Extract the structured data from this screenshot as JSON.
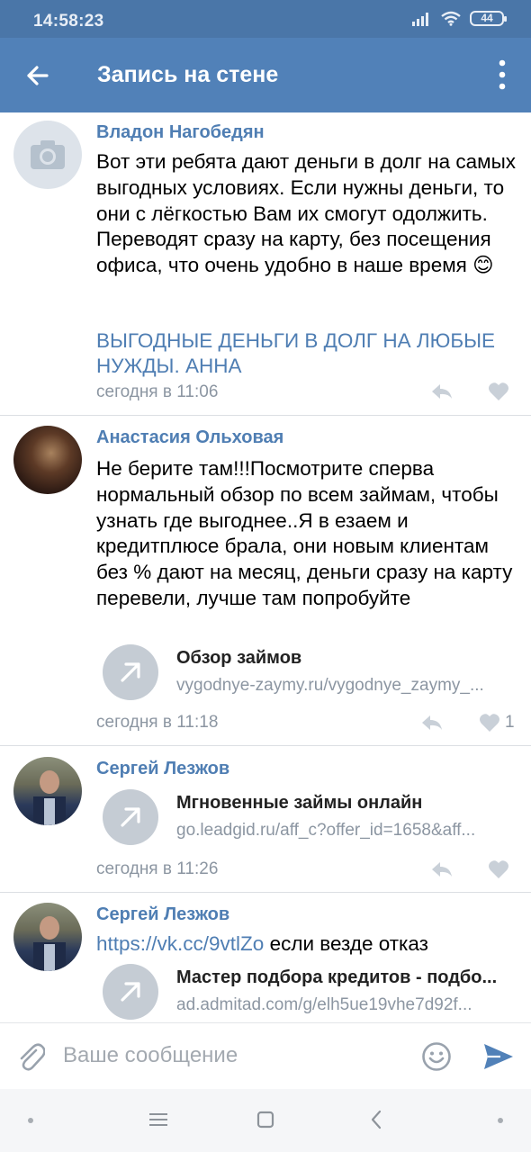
{
  "status": {
    "time": "14:58:23",
    "battery": "44"
  },
  "header": {
    "title": "Запись на стене"
  },
  "comments": [
    {
      "author": "Владон Нагобедян",
      "text": "Вот эти ребята дают деньги в долг на самых выгодных условиях. Если нужны деньги, то они с лёгкостью Вам их смогут одолжить. Переводят сразу на карту, без посещения офиса, что очень удобно в наше время 😊",
      "link_text": "ВЫГОДНЫЕ ДЕНЬГИ В ДОЛГ НА ЛЮБЫЕ НУЖДЫ. АННА",
      "time": "сегодня в 11:06"
    },
    {
      "author": "Анастасия Ольховая",
      "text": "Не берите там!!!Посмотрите сперва нормальный обзор по всем займам, чтобы узнать где выгоднее..Я в езаем и кредитплюсе брала, они новым клиентам без % дают на месяц, деньги сразу на карту перевели, лучше там попробуйте",
      "card": {
        "title": "Обзор займов",
        "url": "vygodnye-zaymy.ru/vygodnye_zaymy_..."
      },
      "time": "сегодня в 11:18",
      "likes": "1"
    },
    {
      "author": "Сергей Лезжов",
      "card": {
        "title": "Мгновенные займы онлайн",
        "url": "go.leadgid.ru/aff_c?offer_id=1658&aff..."
      },
      "time": "сегодня в 11:26"
    },
    {
      "author": "Сергей Лезжов",
      "link": "https://vk.cc/9vtlZo",
      "text_after": " если везде отказ",
      "card": {
        "title": "Мастер подбора кредитов - подбо...",
        "url": "ad.admitad.com/g/elh5ue19vhe7d92f..."
      }
    }
  ],
  "composer": {
    "placeholder": "Ваше сообщение"
  },
  "colors": {
    "header": "#5181b8",
    "statusbar": "#4a76a8",
    "author": "#4f7eb3",
    "meta": "#8c96a2"
  },
  "icons": [
    "back-arrow-icon",
    "more-vertical-icon",
    "camera-icon",
    "reply-icon",
    "heart-icon",
    "link-arrow-icon",
    "attach-icon",
    "smile-icon",
    "send-icon",
    "menu-icon",
    "home-icon",
    "back-icon"
  ]
}
